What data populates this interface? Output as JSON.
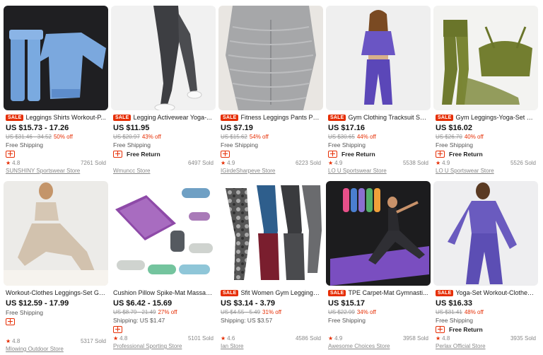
{
  "colors": {
    "sale": "#e62e04",
    "text": "#222222",
    "muted": "#888888"
  },
  "products": [
    {
      "sale_label": "SALE",
      "title": "Leggings Shirts Workout-P...",
      "price": "US $15.73 - 17.26",
      "orig": "US $31.46 - 34.52",
      "off": "50% off",
      "shipping": "Free Shipping",
      "choice": true,
      "free_return": "",
      "rating": "4.8",
      "sold": "7261 Sold",
      "store": "SUNSHINY Sportswear Store"
    },
    {
      "sale_label": "SALE",
      "title": "Legging Activewear Yoga-...",
      "price": "US $11.95",
      "orig": "US $20.97",
      "off": "43% off",
      "shipping": "Free Shipping",
      "choice": true,
      "free_return": "Free Return",
      "rating": "",
      "sold": "6497 Sold",
      "store": "Wmuncc Store"
    },
    {
      "sale_label": "SALE",
      "title": "Fitness Leggings Pants Pu...",
      "price": "US $7.19",
      "orig": "US $15.62",
      "off": "54% off",
      "shipping": "Free Shipping",
      "choice": true,
      "free_return": "",
      "rating": "4.9",
      "sold": "6223 Sold",
      "store": "IGirdeSharpeve Store"
    },
    {
      "sale_label": "SALE",
      "title": "Gym Clothing Tracksuit Shi...",
      "price": "US $17.16",
      "orig": "US $30.65",
      "off": "44% off",
      "shipping": "Free Shipping",
      "choice": true,
      "free_return": "Free Return",
      "rating": "4.9",
      "sold": "5538 Sold",
      "store": "LO U Sportswear Store"
    },
    {
      "sale_label": "SALE",
      "title": "Gym Leggings-Yoga-Set Fo...",
      "price": "US $16.02",
      "orig": "US $26.70",
      "off": "40% off",
      "shipping": "Free Shipping",
      "choice": true,
      "free_return": "Free Return",
      "rating": "4.9",
      "sold": "5526 Sold",
      "store": "LO U Sportswear Store"
    },
    {
      "sale_label": "",
      "title": "Workout-Clothes Leggings-Set Gy...",
      "price": "US $12.59 - 17.99",
      "orig": "",
      "off": "",
      "shipping": "Free Shipping",
      "choice": true,
      "free_return": "",
      "rating": "4.8",
      "sold": "5317 Sold",
      "store": "Mlowing Outdoor Store"
    },
    {
      "sale_label": "",
      "title": "Cushion Pillow Spike-Mat Massage...",
      "price": "US $6.42 - 15.69",
      "orig": "US $8.79 - 21.49",
      "off": "27% off",
      "shipping": "Shipping: US $1.47",
      "choice": true,
      "free_return": "",
      "rating": "4.8",
      "sold": "5101 Sold",
      "store": "Professional Sporting Store"
    },
    {
      "sale_label": "SALE",
      "title": "Sfit Women Gym Leggings-...",
      "price": "US $3.14 - 3.79",
      "orig": "US $4.55 - 5.49",
      "off": "31% off",
      "shipping": "Shipping: US $3.57",
      "choice": false,
      "free_return": "",
      "rating": "4.6",
      "sold": "4586 Sold",
      "store": "Ian Store"
    },
    {
      "sale_label": "SALE",
      "title": "TPE Carpet-Mat Gymnasti...",
      "price": "US $15.17",
      "orig": "US $22.99",
      "off": "34% off",
      "shipping": "Free Shipping",
      "choice": false,
      "free_return": "",
      "rating": "4.9",
      "sold": "3958 Sold",
      "store": "Awesome Choices Store"
    },
    {
      "sale_label": "SALE",
      "title": "Yoga-Set Workout-Clothes...",
      "price": "US $16.33",
      "orig": "US $31.41",
      "off": "48% off",
      "shipping": "Free Shipping",
      "choice": true,
      "free_return": "Free Return",
      "rating": "4.8",
      "sold": "3935 Sold",
      "store": "Perlax Official Store"
    }
  ]
}
